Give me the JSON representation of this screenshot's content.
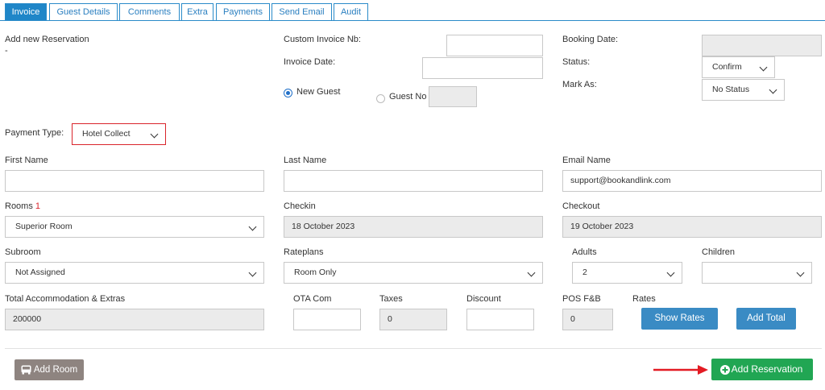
{
  "tabs": [
    {
      "label": "Invoice",
      "active": true
    },
    {
      "label": "Guest Details"
    },
    {
      "label": "Comments"
    },
    {
      "label": "Extra"
    },
    {
      "label": "Payments"
    },
    {
      "label": "Send Email"
    },
    {
      "label": "Audit"
    }
  ],
  "header": {
    "add_new_reservation": "Add new Reservation",
    "dash": "-",
    "custom_invoice_label": "Custom Invoice Nb:",
    "custom_invoice_value": "",
    "invoice_date_label": "Invoice Date:",
    "invoice_date_value": "",
    "new_guest_label": "New Guest",
    "guest_no_label": "Guest No",
    "guest_no_value": "",
    "booking_date_label": "Booking Date:",
    "booking_date_value": "",
    "status_label": "Status:",
    "status_value": "Confirm",
    "mark_as_label": "Mark As:",
    "mark_as_value": "No Status"
  },
  "payment": {
    "label": "Payment Type:",
    "value": "Hotel Collect"
  },
  "guest": {
    "first_name_label": "First Name",
    "first_name_value": "",
    "last_name_label": "Last Name",
    "last_name_value": "",
    "email_label": "Email Name",
    "email_value": "support@bookandlink.com"
  },
  "stay": {
    "rooms_label": "Rooms",
    "rooms_required": "1",
    "rooms_value": "Superior Room",
    "checkin_label": "Checkin",
    "checkin_value": "18 October 2023",
    "checkout_label": "Checkout",
    "checkout_value": "19 October 2023",
    "subroom_label": "Subroom",
    "subroom_value": "Not Assigned",
    "rateplans_label": "Rateplans",
    "rateplans_value": "Room Only",
    "adults_label": "Adults",
    "adults_value": "2",
    "children_label": "Children",
    "children_value": ""
  },
  "totals": {
    "total_label": "Total Accommodation & Extras",
    "total_value": "200000",
    "ota_label": "OTA Com",
    "ota_value": "",
    "taxes_label": "Taxes",
    "taxes_value": "0",
    "discount_label": "Discount",
    "discount_value": "",
    "pos_label": "POS F&B",
    "pos_value": "0",
    "rates_label": "Rates",
    "show_rates_label": "Show Rates",
    "add_total_label": "Add Total"
  },
  "footer": {
    "add_room_label": "Add Room",
    "add_reservation_label": "Add Reservation"
  },
  "colors": {
    "tab_blue": "#1f86c8",
    "button_blue": "#3a8bc4",
    "green": "#21a653",
    "gray_button": "#8e8480",
    "payment_border": "#d9242b",
    "arrow_red": "#e31b23"
  },
  "icons": {
    "add_room": "bus-icon",
    "add_reservation": "plus-circle-icon",
    "arrow": "arrow-right-icon"
  }
}
